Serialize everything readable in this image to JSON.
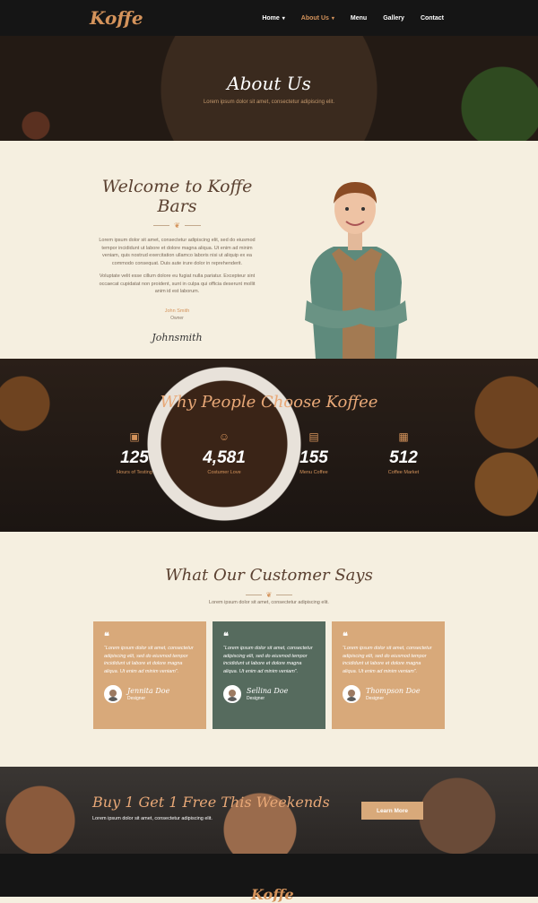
{
  "nav": {
    "logo": "Koffe",
    "items": [
      "Home",
      "About Us",
      "Menu",
      "Gallery",
      "Contact"
    ]
  },
  "hero": {
    "title": "About Us",
    "subtitle": "Lorem ipsum dolor sit amet, consectetur adipiscing elit."
  },
  "welcome": {
    "title": "Welcome to Koffe Bars",
    "p1": "Lorem ipsum dolor sit amet, consectetur adipiscing elit, sed do eiusmod tempor incididunt ut labore et dolore magna aliqua. Ut enim ad minim veniam, quis nostrud exercitation ullamco laboris nisi ut aliquip ex ea commodo consequat. Duis aute irure dolor in reprehenderit.",
    "p2": "Voluptate velit esse cillum dolore eu fugiat nulla pariatur. Excepteur sint occaecat cupidatat non proident, sunt in culpa qui officia deserunt mollit anim id est laborum.",
    "owner_name": "John Smith",
    "owner_role": "Owner",
    "signature": "Johnsmith"
  },
  "why": {
    "title": "Why People Choose Koffee",
    "stats": [
      {
        "icon": "briefcase-icon",
        "num": "125",
        "label": "Hours of Testing"
      },
      {
        "icon": "person-icon",
        "num": "4,581",
        "label": "Costumer Love"
      },
      {
        "icon": "clipboard-icon",
        "num": "155",
        "label": "Menu Coffee"
      },
      {
        "icon": "building-icon",
        "num": "512",
        "label": "Coffee Market"
      }
    ]
  },
  "testimonials": {
    "title": "What Our Customer Says",
    "subtitle": "Lorem ipsum dolor sit amet, consectetur adipiscing elit.",
    "cards": [
      {
        "text": "“Lorem ipsum dolor sit amet, consectetur adipiscing elit, sed do eiusmod tempor incididunt ut labore et dolore magna aliqua. Ut enim ad minim veniam”.",
        "name": "Jennita Doe",
        "role": "Designer"
      },
      {
        "text": "“Lorem ipsum dolor sit amet, consectetur adipiscing elit, sed do eiusmod tempor incididunt ut labore et dolore magna aliqua. Ut enim ad minim veniam”.",
        "name": "Sellina Doe",
        "role": "Designer"
      },
      {
        "text": "“Lorem ipsum dolor sit amet, consectetur adipiscing elit, sed do eiusmod tempor incididunt ut labore et dolore magna aliqua. Ut enim ad minim veniam”.",
        "name": "Thompson Doe",
        "role": "Designer"
      }
    ]
  },
  "promo": {
    "title": "Buy 1 Get 1 Free This Weekends",
    "subtitle": "Lorem ipsum dolor sit amet, consectetur adipiscing elit.",
    "button": "Learn More"
  },
  "footer": {
    "logo": "Koffe"
  }
}
